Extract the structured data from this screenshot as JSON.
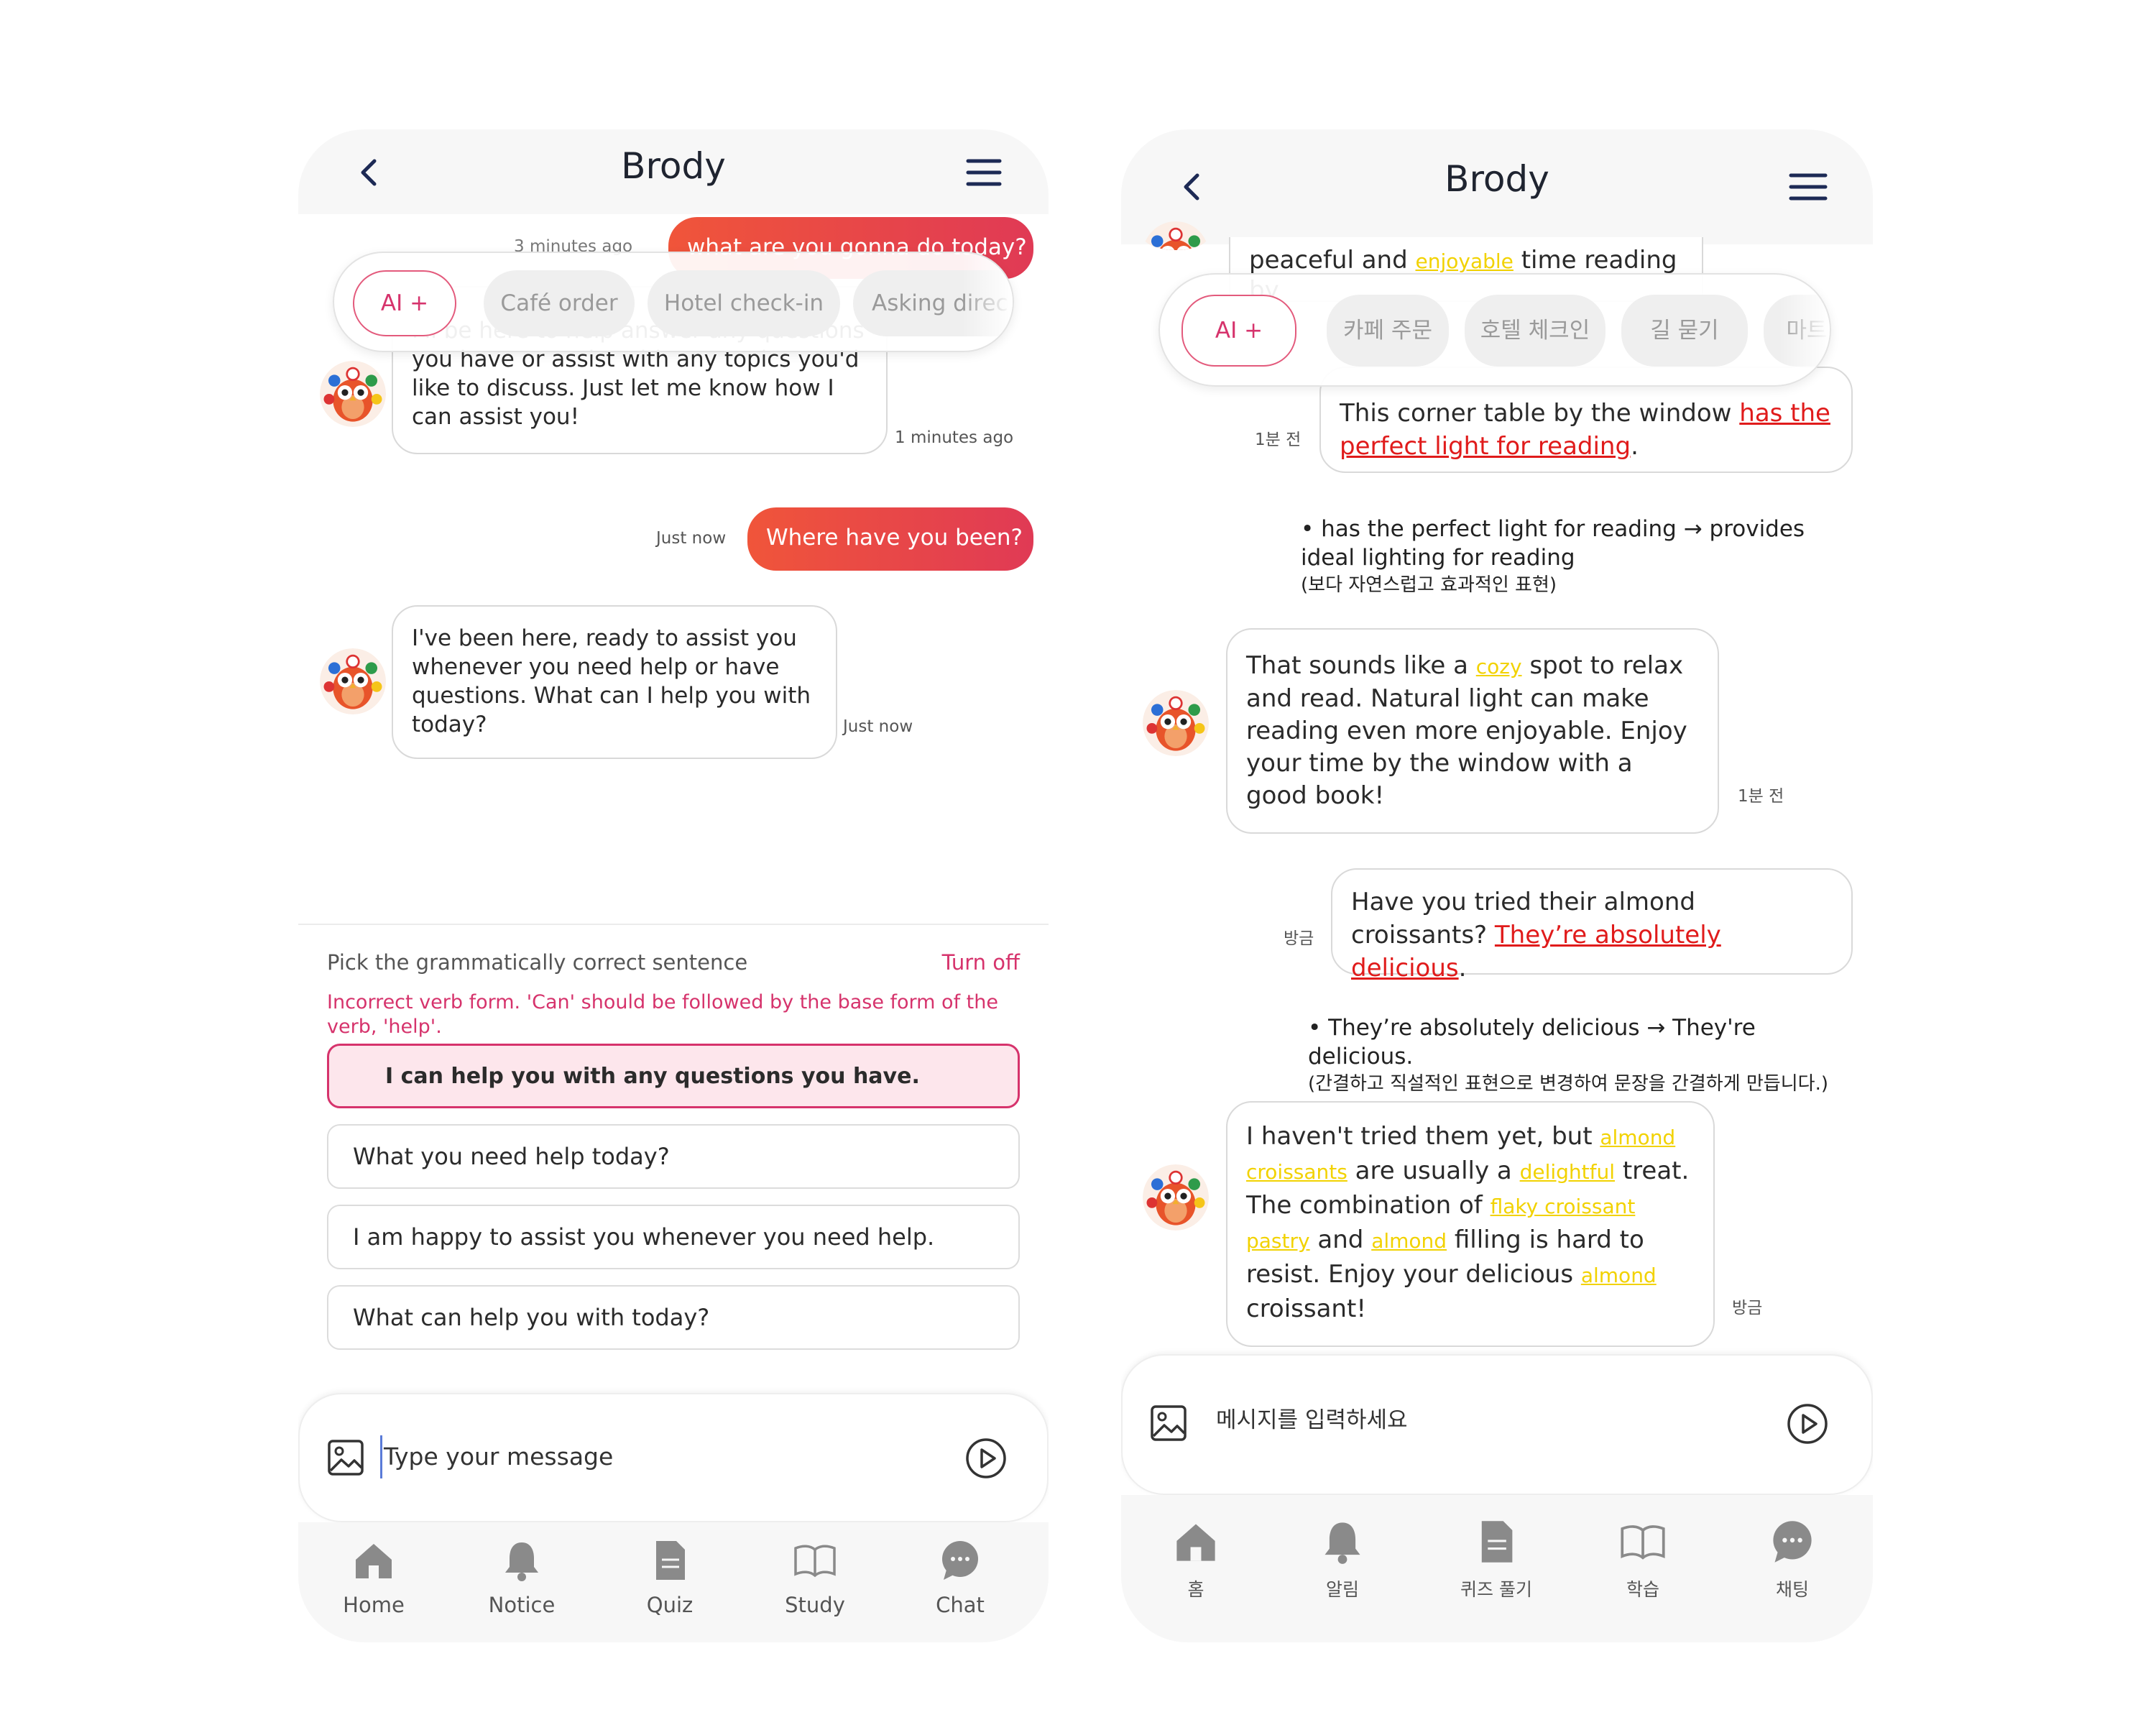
{
  "left": {
    "header": {
      "title": "Brody"
    },
    "chips": [
      "AI +",
      "Café order",
      "Hotel check-in",
      "Asking direc"
    ],
    "messages": {
      "top_user": "what are you gonna do today?",
      "top_user_ts": "3 minutes ago",
      "bot1": "I'll be here to help answer any questions you have or assist with any topics you'd like to discuss. Just let me know how I can assist you!",
      "bot1_ts": "1 minutes ago",
      "user2": "Where have you been?",
      "user2_ts": "Just now",
      "bot2": "I've been here, ready to assist you whenever you need help or have questions. What can I help you with today?",
      "bot2_ts": "Just now"
    },
    "quiz": {
      "title": "Pick the grammatically correct sentence",
      "turn_off": "Turn off",
      "message": "Incorrect verb form. 'Can' should be followed by the base form of the verb, 'help'.",
      "options": [
        "I can help you with any questions you have.",
        "What you need help today?",
        "I am happy to assist you whenever you need help.",
        "What can help you with today?"
      ]
    },
    "input": {
      "placeholder": "Type your message"
    },
    "tabs": [
      "Home",
      "Notice",
      "Quiz",
      "Study",
      "Chat"
    ]
  },
  "right": {
    "header": {
      "title": "Brody"
    },
    "chips": [
      "AI +",
      "카페 주문",
      "호텔 체크인",
      "길 묻기",
      "마트"
    ],
    "messages": {
      "top_partial": {
        "a": "peaceful and ",
        "hl": "enjoyable",
        "b": " time reading by"
      },
      "user1": {
        "a": "This corner table by the window ",
        "err": "has the perfect light for reading",
        "b": "."
      },
      "user1_ts": "1분 전",
      "note1": {
        "line": "• has the perfect light for reading → provides ideal lighting for reading",
        "kr": "(보다 자연스럽고 효과적인 표현)"
      },
      "bot1": {
        "a": "That sounds like a ",
        "hl": "cozy",
        "b": " spot to relax and read. Natural light can make reading even more enjoyable. Enjoy your time by the window with a good book!"
      },
      "bot1_ts": "1분 전",
      "user2": {
        "a": "Have you tried their almond croissants? ",
        "err": "They’re absolutely delicious",
        "b": "."
      },
      "user2_ts": "방금",
      "note2": {
        "line": "• They’re absolutely delicious → They're delicious.",
        "kr": "(간결하고 직설적인 표현으로 변경하여 문장을 간결하게 만듭니다.)"
      },
      "bot2": {
        "t1": "I haven't tried them yet, but ",
        "h1": "almond croissants",
        "t2": " are usually a ",
        "h2": "delightful",
        "t3": " treat. The combination of ",
        "h3": "flaky croissant pastry",
        "t4": " and ",
        "h4": "almond",
        "t5": " filling is hard to resist. Enjoy your delicious ",
        "h5": "almond",
        "t6": " croissant!"
      },
      "bot2_ts": "방금"
    },
    "input": {
      "placeholder": "메시지를 입력하세요"
    },
    "tabs": [
      "홈",
      "알림",
      "퀴즈 풀기",
      "학습",
      "채팅"
    ]
  },
  "colors": {
    "accent": "#d6336c",
    "user_gradient_start": "#f0553a",
    "user_gradient_end": "#e03a55",
    "highlight": "#f2d200",
    "error": "#e01b1b"
  },
  "icons": [
    "back-chevron-icon",
    "hamburger-menu-icon",
    "image-icon",
    "send-play-icon",
    "home-icon",
    "bell-icon",
    "document-icon",
    "book-icon",
    "chat-bubble-icon",
    "owl-avatar-icon"
  ]
}
